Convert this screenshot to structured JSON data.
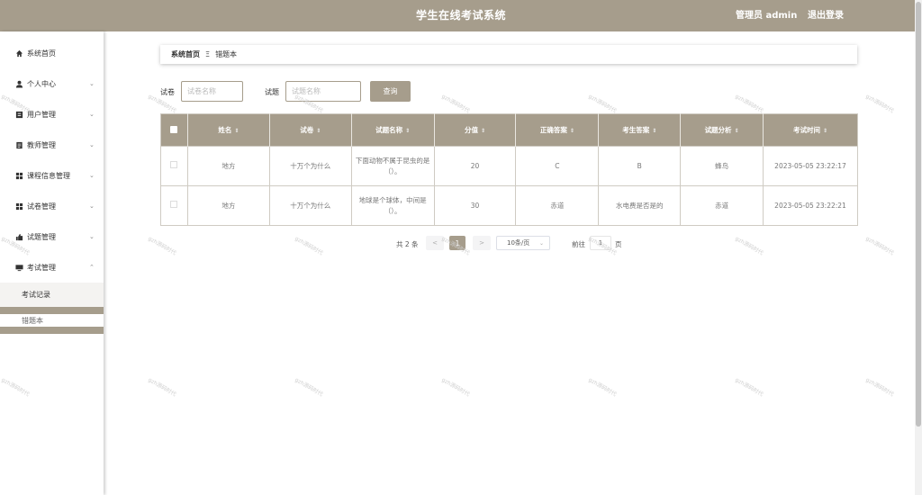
{
  "header": {
    "title": "学生在线考试系统",
    "admin_label": "管理员 admin",
    "logout_label": "退出登录"
  },
  "sidebar": {
    "items": [
      {
        "label": "系统首页",
        "icon": "home-icon",
        "glyph": "⌂",
        "has_arrow": false
      },
      {
        "label": "个人中心",
        "icon": "user-icon",
        "glyph": "●",
        "has_arrow": true
      },
      {
        "label": "用户管理",
        "icon": "user-manage-icon",
        "glyph": "▣",
        "has_arrow": true
      },
      {
        "label": "教师管理",
        "icon": "teacher-icon",
        "glyph": "▤",
        "has_arrow": true
      },
      {
        "label": "课程信息管理",
        "icon": "grid-icon",
        "glyph": "▦",
        "has_arrow": true
      },
      {
        "label": "试卷管理",
        "icon": "grid-icon",
        "glyph": "▦",
        "has_arrow": true
      },
      {
        "label": "试题管理",
        "icon": "thumbs-up-icon",
        "glyph": "▰",
        "has_arrow": true
      },
      {
        "label": "考试管理",
        "icon": "monitor-icon",
        "glyph": "▬",
        "has_arrow": true
      }
    ],
    "sub_items": [
      {
        "label": "考试记录"
      },
      {
        "label": "错题本"
      }
    ],
    "arrow_down": "⌄",
    "arrow_up": "⌃"
  },
  "breadcrumb": {
    "home": "系统首页",
    "separator": "Ξ",
    "current": "错题本"
  },
  "search": {
    "paper_label": "试卷",
    "paper_placeholder": "试卷名称",
    "question_label": "试题",
    "question_placeholder": "试题名称",
    "button_label": "查询"
  },
  "table": {
    "columns": [
      "姓名",
      "试卷",
      "试题名称",
      "分值",
      "正确答案",
      "考生答案",
      "试题分析",
      "考试时间"
    ],
    "sort_icon": "⇕",
    "rows": [
      [
        "地方",
        "十万个为什么",
        "下面动物不属于昆虫的是（）。",
        "20",
        "C",
        "B",
        "蜂鸟",
        "2023-05-05 23:22:17"
      ],
      [
        "地方",
        "十万个为什么",
        "地球是个球体，中间是（）。",
        "30",
        "赤道",
        "水电费是否是的",
        "赤道",
        "2023-05-05 23:22:21"
      ]
    ]
  },
  "pagination": {
    "total": "共 2 条",
    "prev": "<",
    "page": "1",
    "next": ">",
    "page_size": "10条/页",
    "goto_label": "前往",
    "goto_value": "1",
    "page_unit": "页"
  },
  "watermark": "gzh源码时代"
}
